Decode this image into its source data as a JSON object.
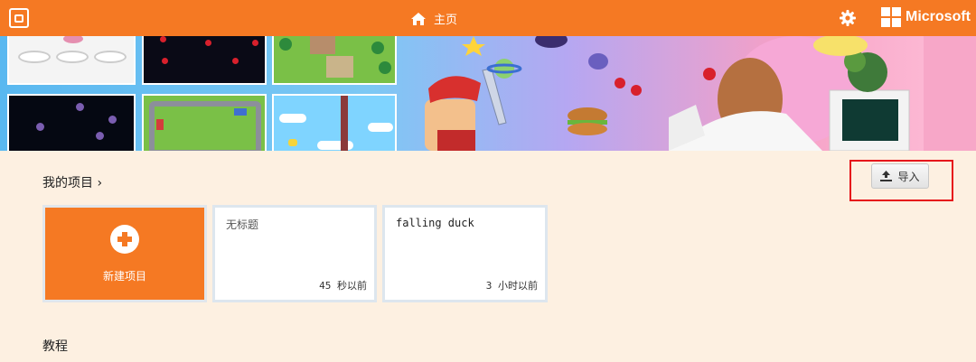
{
  "header": {
    "home_label": "主页",
    "brand": "Microsoft",
    "icons": {
      "logo": "makecode-arcade-logo-icon",
      "home": "home-icon",
      "settings": "gear-icon",
      "brand": "microsoft-logo-icon"
    },
    "colors": {
      "bar": "#f57923",
      "text": "#ffffff"
    }
  },
  "banner": {
    "thumbnails": [
      "plates-game",
      "cherries-space-game",
      "forest-village-game",
      "asteroids-game",
      "race-track-game",
      "sky-platform-game"
    ],
    "illustration": "arcade-characters-hero-art"
  },
  "my_projects": {
    "title": "我的项目 ›",
    "import_label": "导入",
    "import_icon": "upload-icon",
    "new_project_label": "新建项目",
    "projects": [
      {
        "name": "无标题",
        "time": "45 秒以前"
      },
      {
        "name": "falling duck",
        "time": "3 小时以前"
      }
    ]
  },
  "tutorials": {
    "title": "教程"
  },
  "colors": {
    "accent": "#f57923",
    "page_bg": "#fdf0e1",
    "highlight": "#e6131b"
  }
}
